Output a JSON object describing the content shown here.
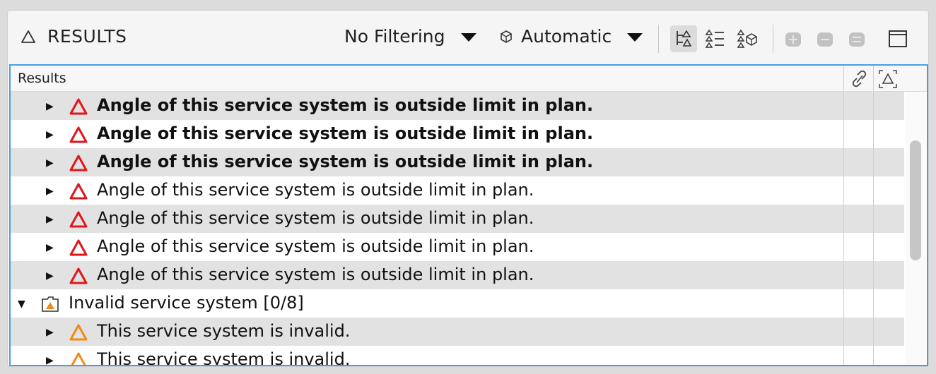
{
  "header": {
    "title": "RESULTS",
    "filter_label": "No Filtering",
    "mode_label": "Automatic",
    "icons": [
      "results-triangle-icon",
      "tree-view-icon",
      "list-view-icon",
      "grouped-view-icon",
      "expand-all-icon",
      "collapse-all-icon",
      "remove-icon",
      "window-maximize-icon"
    ]
  },
  "table": {
    "column_title": "Results",
    "header_icons": [
      "link-icon",
      "status-icon"
    ],
    "rows": [
      {
        "text": "Angle of this service system is outside limit in plan.",
        "bold": true,
        "level": 1,
        "severity": "error",
        "expanded": false
      },
      {
        "text": "Angle of this service system is outside limit in plan.",
        "bold": true,
        "level": 1,
        "severity": "error",
        "expanded": false
      },
      {
        "text": "Angle of this service system is outside limit in plan.",
        "bold": true,
        "level": 1,
        "severity": "error",
        "expanded": false
      },
      {
        "text": "Angle of this service system is outside limit in plan.",
        "bold": false,
        "level": 1,
        "severity": "error",
        "expanded": false
      },
      {
        "text": "Angle of this service system is outside limit in plan.",
        "bold": false,
        "level": 1,
        "severity": "error",
        "expanded": false
      },
      {
        "text": "Angle of this service system is outside limit in plan.",
        "bold": false,
        "level": 1,
        "severity": "error",
        "expanded": false
      },
      {
        "text": "Angle of this service system is outside limit in plan.",
        "bold": false,
        "level": 1,
        "severity": "error",
        "expanded": false
      },
      {
        "text": "Invalid service system [0/8]",
        "bold": false,
        "level": 0,
        "severity": "folder-warning",
        "expanded": true
      },
      {
        "text": "This service system is invalid.",
        "bold": false,
        "level": 1,
        "severity": "warning",
        "expanded": false
      },
      {
        "text": "This service system is invalid.",
        "bold": false,
        "level": 1,
        "severity": "warning",
        "expanded": false
      }
    ]
  },
  "colors": {
    "error": "#e0161a",
    "warning": "#f08a1a",
    "selection_border": "#4a9ee0",
    "row_shade": "#e2e2e2"
  }
}
